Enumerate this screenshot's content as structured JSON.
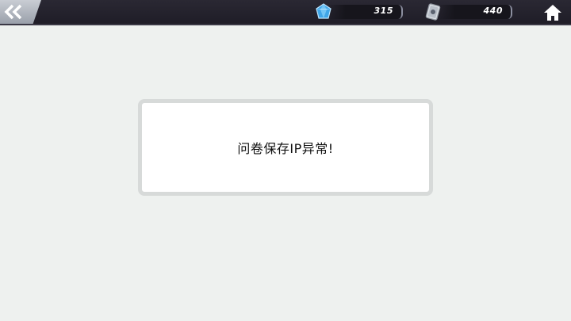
{
  "topbar": {
    "back_icon": "double-chevron-left-icon",
    "gems": {
      "icon": "blue-gem-icon",
      "value": "315"
    },
    "tickets": {
      "icon": "ticket-card-icon",
      "value": "440"
    },
    "home_icon": "home-icon"
  },
  "dialog": {
    "message": "问卷保存IP异常!"
  },
  "colors": {
    "background": "#eef1ef",
    "topbar": "#2a2833",
    "dialog_border": "#d7dad9"
  }
}
